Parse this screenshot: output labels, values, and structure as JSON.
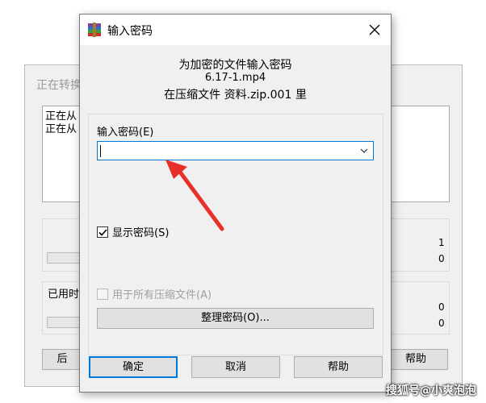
{
  "background_window": {
    "title": "正在转换",
    "log_lines": [
      "正在从",
      "正在从"
    ],
    "counts_top": [
      "1",
      "0"
    ],
    "elapsed_label": "已用时",
    "counts_bottom": [
      "0",
      "0"
    ],
    "left_button_label": "后",
    "help_button_label": "帮助"
  },
  "dialog": {
    "title": "输入密码",
    "header": {
      "line1": "为加密的文件输入密码",
      "filename": "6.17-1.mp4",
      "archive_line": "在压缩文件 资料.zip.001 里"
    },
    "password_label": "输入密码(E)",
    "password_value": "",
    "show_password_label": "显示密码(S)",
    "show_password_checked": true,
    "use_for_all_label": "用于所有压缩文件(A)",
    "use_for_all_checked": false,
    "organize_button": "整理密码(O)...",
    "ok_button": "确定",
    "cancel_button": "取消",
    "help_button": "帮助"
  },
  "annotation": {
    "arrow_color": "#e8302a"
  },
  "watermark": "搜狐号@小爽泡泡",
  "icons": {
    "app": "winrar-icon",
    "close": "close-icon",
    "dropdown": "chevron-down-icon",
    "check": "check-icon"
  }
}
